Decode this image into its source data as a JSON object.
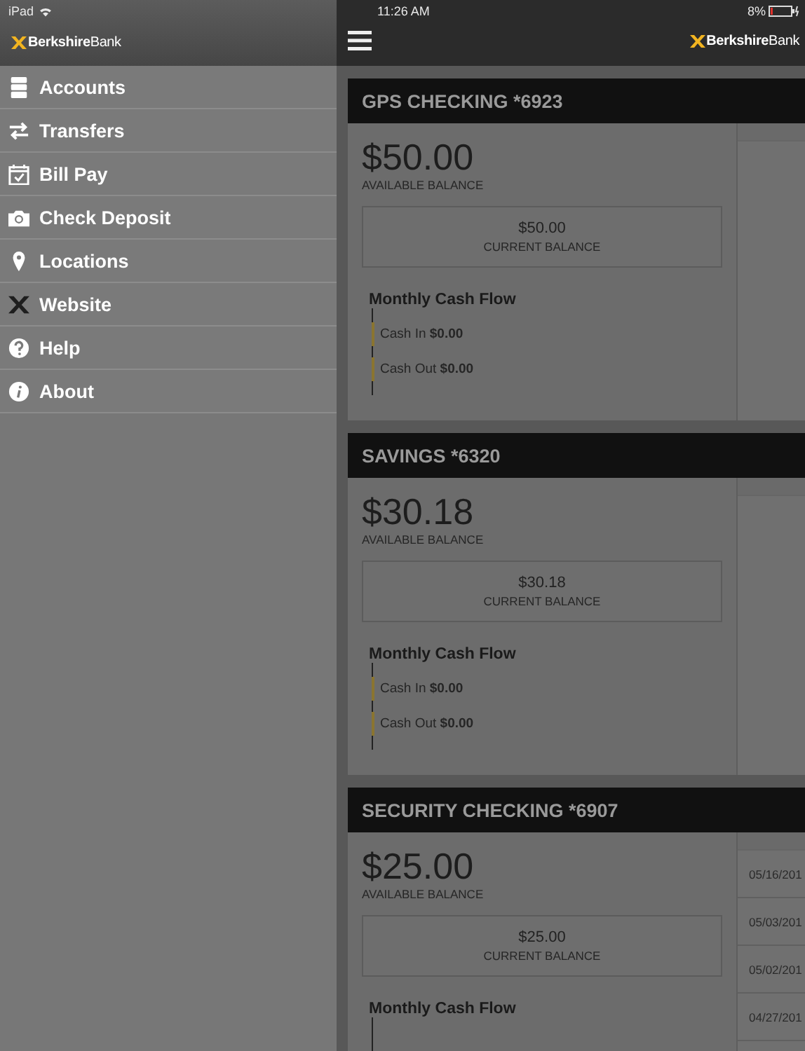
{
  "status_bar": {
    "device": "iPad",
    "time": "11:26 AM",
    "battery": "8%"
  },
  "sidebar": {
    "logo": "**Berkshire**Bank",
    "items": [
      {
        "label": "Accounts"
      },
      {
        "label": "Transfers"
      },
      {
        "label": "Bill Pay"
      },
      {
        "label": "Check Deposit"
      },
      {
        "label": "Locations"
      },
      {
        "label": "Website"
      },
      {
        "label": "Help"
      },
      {
        "label": "About"
      }
    ]
  },
  "top_bar": {
    "logo": "**Berkshire**Bank"
  },
  "accounts": [
    {
      "name": "GPS CHECKING *6923",
      "available": "$50.00",
      "available_label": "AVAILABLE BALANCE",
      "current": "$50.00",
      "current_label": "CURRENT BALANCE",
      "cash_flow_title": "Monthly Cash Flow",
      "cash_rows": [
        {
          "label": "Cash In",
          "value": "$0.00"
        },
        {
          "label": "Cash Out",
          "value": "$0.00"
        }
      ]
    },
    {
      "name": "SAVINGS *6320",
      "available": "$30.18",
      "available_label": "AVAILABLE BALANCE",
      "current": "$30.18",
      "current_label": "CURRENT BALANCE",
      "cash_flow_title": "Monthly Cash Flow",
      "cash_rows": [
        {
          "label": "Cash In",
          "value": "$0.00"
        },
        {
          "label": "Cash Out",
          "value": "$0.00"
        }
      ]
    },
    {
      "name": "SECURITY CHECKING *6907",
      "available": "$25.00",
      "available_label": "AVAILABLE BALANCE",
      "current": "$25.00",
      "current_label": "CURRENT BALANCE",
      "cash_flow_title": "Monthly Cash Flow",
      "dates": [
        "05/16/201",
        "05/03/201",
        "05/02/201",
        "04/27/201"
      ]
    }
  ]
}
